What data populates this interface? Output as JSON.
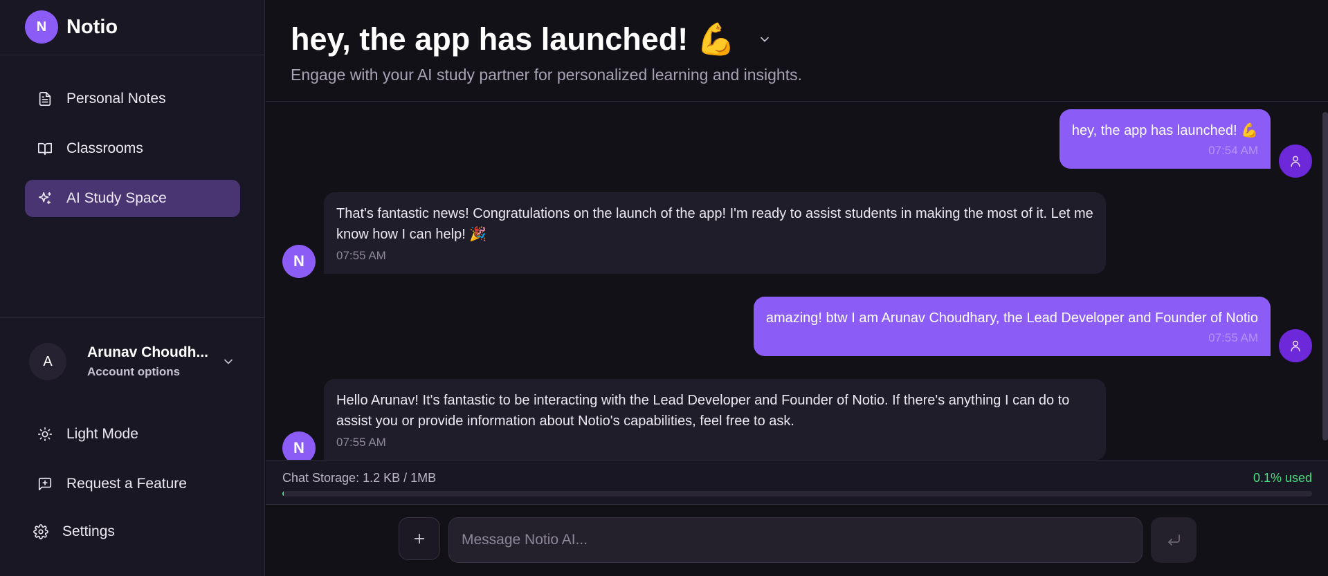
{
  "brand": {
    "initial": "N",
    "name": "Notio"
  },
  "nav": {
    "items": [
      {
        "label": "Personal Notes",
        "icon": "document-icon"
      },
      {
        "label": "Classrooms",
        "icon": "book-icon"
      },
      {
        "label": "AI Study Space",
        "icon": "sparkles-icon",
        "active": true
      }
    ]
  },
  "account": {
    "initial": "A",
    "name": "Arunav Choudh...",
    "subtitle": "Account options"
  },
  "bottom_nav": {
    "light_mode": "Light Mode",
    "request_feature": "Request a Feature",
    "settings": "Settings"
  },
  "header": {
    "title": "hey, the app has launched! 💪",
    "subtitle": "Engage with your AI study partner for personalized learning and insights."
  },
  "messages": [
    {
      "role": "user",
      "text": "hey, the app has launched! 💪",
      "time": "07:54 AM"
    },
    {
      "role": "ai",
      "avatar": "N",
      "text": "That's fantastic news! Congratulations on the launch of the app! I'm ready to assist students in making the most of it. Let me know how I can help! 🎉",
      "time": "07:55 AM"
    },
    {
      "role": "user",
      "text": "amazing! btw I am Arunav Choudhary, the Lead Developer and Founder of Notio",
      "time": "07:55 AM"
    },
    {
      "role": "ai",
      "avatar": "N",
      "text": "Hello Arunav! It's fantastic to be interacting with the Lead Developer and Founder of Notio. If there's anything I can do to assist you or provide information about Notio's capabilities, feel free to ask.",
      "time": "07:55 AM"
    }
  ],
  "storage": {
    "label": "Chat Storage: 1.2 KB / 1MB",
    "percent_label": "0.1% used",
    "used_fraction": 0.001
  },
  "composer": {
    "placeholder": "Message Notio AI..."
  },
  "colors": {
    "accent": "#8b5cf6",
    "success": "#4ade80",
    "background": "#131118",
    "sidebar": "#1a1724"
  }
}
